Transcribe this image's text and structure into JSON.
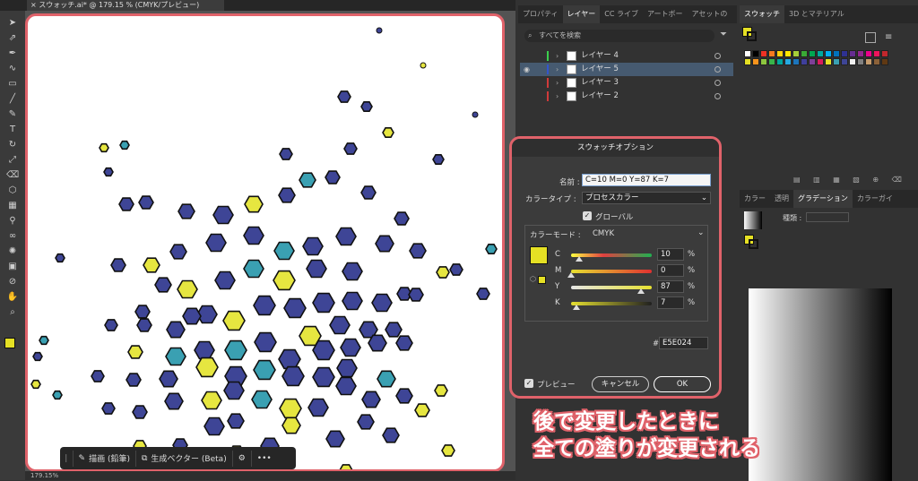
{
  "document": {
    "tab_title": "スウォッチ.ai* @ 179.15 % (CMYK/プレビュー)",
    "close_glyph": "×",
    "zoom": "179.15%",
    "status_mode": "選択"
  },
  "tools": [
    "selection-icon",
    "direct-selection-icon",
    "pen-icon",
    "curvature-icon",
    "rectangle-icon",
    "paintbrush-icon",
    "pencil-icon",
    "type-icon",
    "rotate-icon",
    "scale-icon",
    "eraser-icon",
    "shape-builder-icon",
    "gradient-icon",
    "eyedropper-icon",
    "blend-icon",
    "symbol-sprayer-icon",
    "artboard-icon",
    "slice-icon",
    "hand-icon",
    "zoom-icon"
  ],
  "colors": {
    "accent_border": "#e0626a",
    "dark_blue": "#3e4596",
    "teal": "#3aa0b2",
    "yellow": "#e6e640",
    "selection_row": "#465a70"
  },
  "layers_panel": {
    "tabs": [
      "プロパティ",
      "レイヤー",
      "CC ライブ",
      "アートボー",
      "アセットの"
    ],
    "search_placeholder": "すべてを検索",
    "layers": [
      {
        "name": "レイヤー 4",
        "color": "#3bd04d",
        "selected": false
      },
      {
        "name": "レイヤー 5",
        "color": "#3355cc",
        "selected": true
      },
      {
        "name": "レイヤー 3",
        "color": "#d03a3a",
        "selected": false
      },
      {
        "name": "レイヤー 2",
        "color": "#d03a3a",
        "selected": false
      }
    ]
  },
  "swatches_panel": {
    "tabs": [
      "スウォッチ",
      "3D とマテリアル"
    ]
  },
  "gradient_panel": {
    "tabs": [
      "カラー",
      "透明",
      "グラデーション",
      "カラーガイ"
    ],
    "type_label": "種類 :"
  },
  "dialog": {
    "title": "スウォッチオプション",
    "name_label": "名前 :",
    "name_value": "C=10 M=0 Y=87 K=7",
    "color_type_label": "カラータイプ :",
    "color_type_value": "プロセスカラー",
    "global_label": "グローバル",
    "global_checked": true,
    "color_mode_label": "カラーモード :",
    "color_mode_value": "CMYK",
    "channels": [
      {
        "label": "C",
        "value": "10",
        "unit": "%",
        "fraction": 0.1
      },
      {
        "label": "M",
        "value": "0",
        "unit": "%",
        "fraction": 0.0
      },
      {
        "label": "Y",
        "value": "87",
        "unit": "%",
        "fraction": 0.87
      },
      {
        "label": "K",
        "value": "7",
        "unit": "%",
        "fraction": 0.07
      }
    ],
    "hex_prefix": "#",
    "hex_value": "E5E024",
    "preview_label": "プレビュー",
    "preview_checked": true,
    "cancel_label": "キャンセル",
    "ok_label": "OK",
    "swatch_color": "#e5e024"
  },
  "context_bar": {
    "draw_label": "描画 (鉛筆)",
    "vector_label": "生成ベクター (Beta)",
    "more": "•••"
  },
  "annotation": {
    "line1": "後で変更したときに",
    "line2": "全ての塗りが変更される"
  }
}
